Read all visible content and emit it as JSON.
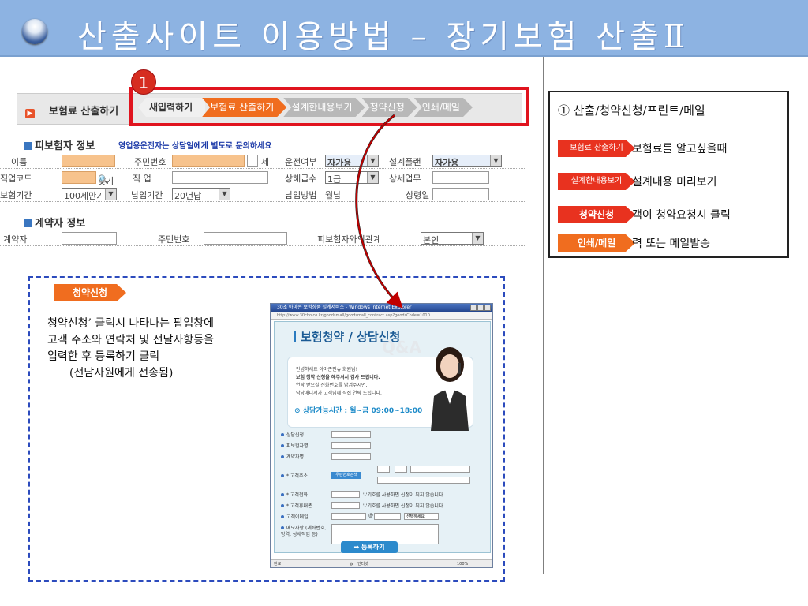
{
  "header": {
    "title": "산출사이트 이용방법 – 장기보험 산출Ⅱ"
  },
  "form": {
    "calc_title": "보험료 산출하기",
    "step_number": "1",
    "steps": [
      "새입력하기",
      "보험료 산출하기",
      "설계한내용보기",
      "청약신청",
      "인쇄/메일"
    ],
    "insured_section": "피보험자 정보",
    "notice": "영업용운전자는 상담일에게 별도로 문의하세요",
    "labels": {
      "name": "이름",
      "rrn": "주민번호",
      "age_suffix": "세",
      "driving": "운전여부",
      "plan": "설계플랜",
      "job_code": "직업코드",
      "find": "찾기",
      "job": "직 업",
      "pay_count": "상해급수",
      "detail_job": "상세업무",
      "ins_period": "보험기간",
      "pay_period": "납입기간",
      "pay_method": "납입방법",
      "pay_method_value": "월납",
      "upper_age": "상령일"
    },
    "values": {
      "driving": "자가용",
      "plan": "자가용",
      "pay_count": "1급",
      "ins_period": "100세만기",
      "pay_period": "20년납"
    },
    "contractor_section": "계약자 정보",
    "contractor_labels": {
      "contractor": "계약자",
      "rrn": "주민번호",
      "relation": "피보험자와의관계"
    },
    "relation_value": "본인"
  },
  "callout": {
    "tag": "청약신청",
    "description_lines": [
      "청약신청’ 클릭시 나타나는 팝업창에",
      "고객 주소와 연락처 및 전달사항등을",
      "입력한 후 등록하기 클릭"
    ],
    "description_note": "(전담사원에게 전송됨)"
  },
  "popup": {
    "window_title": "30초 아마존 보험상품 설계서비스 - Windows Internet Explorer",
    "address": "http://www.30cho.co.kr/goodsmall/goodsmall_contract.asp?goodsCode=1010",
    "heading": "보험청약 / 상담신청",
    "greeting_lines": [
      "안녕하세요 아마존인슈 회원님!",
      "보험 청약 신청을 해주셔서 감사 드립니다.",
      "연락 받으실 전화번호를 남겨주시면,",
      "담당매니저가 고객님께 직접 연락 드립니다."
    ],
    "hours": "상담가능시간 : 월~금 09:00~18:00",
    "watermark": "Q&A",
    "fields": [
      "상담신청",
      "피보험자명",
      "계약자명",
      "* 고객주소",
      "* 고객전화",
      "* 고객휴대폰",
      "고객이메일",
      "메모사항 (계좌번호, 방역, 상세직업 등)"
    ],
    "zip_button": "우편번호검색",
    "phone_note": "'-'기호를 사용하면 신청이 되지 않습니다.",
    "email_at": "@",
    "email_select": "선택하세요",
    "submit": "등록하기",
    "status_left": "완료",
    "status_zone": "인터넷",
    "status_zoom": "100%"
  },
  "legend": {
    "title": "① 산출/청약신청/프린트/메일",
    "items": [
      {
        "tag": "보험료 산출하기",
        "text": "보험료를 알고싶을때"
      },
      {
        "tag": "설계한내용보기",
        "text": "설계내용 미리보기"
      },
      {
        "tag": "청약신청",
        "text": "객이 청약요청시 클릭"
      },
      {
        "tag": "인쇄/메일",
        "text": "력 또는 메일발송"
      }
    ]
  },
  "colors": {
    "header_bg": "#8db3e2",
    "accent_orange": "#f06d1f",
    "accent_red": "#e8321f",
    "highlight_box": "#e0141e",
    "dashed_border": "#2c4bbd",
    "curve_arrow": "#c00000"
  }
}
